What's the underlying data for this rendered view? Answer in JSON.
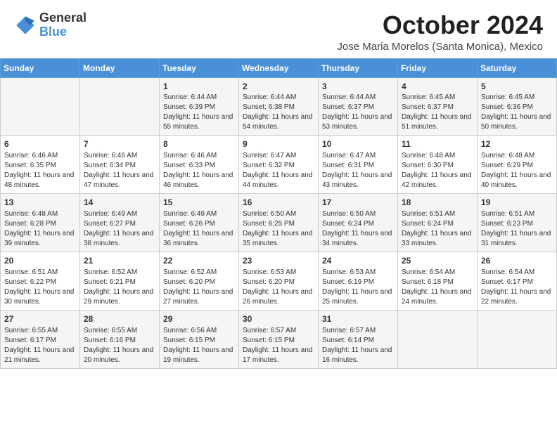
{
  "header": {
    "logo_general": "General",
    "logo_blue": "Blue",
    "month": "October 2024",
    "location": "Jose Maria Morelos (Santa Monica), Mexico"
  },
  "days_of_week": [
    "Sunday",
    "Monday",
    "Tuesday",
    "Wednesday",
    "Thursday",
    "Friday",
    "Saturday"
  ],
  "weeks": [
    [
      {
        "day": "",
        "info": ""
      },
      {
        "day": "",
        "info": ""
      },
      {
        "day": "1",
        "info": "Sunrise: 6:44 AM\nSunset: 6:39 PM\nDaylight: 11 hours and 55 minutes."
      },
      {
        "day": "2",
        "info": "Sunrise: 6:44 AM\nSunset: 6:38 PM\nDaylight: 11 hours and 54 minutes."
      },
      {
        "day": "3",
        "info": "Sunrise: 6:44 AM\nSunset: 6:37 PM\nDaylight: 11 hours and 53 minutes."
      },
      {
        "day": "4",
        "info": "Sunrise: 6:45 AM\nSunset: 6:37 PM\nDaylight: 11 hours and 51 minutes."
      },
      {
        "day": "5",
        "info": "Sunrise: 6:45 AM\nSunset: 6:36 PM\nDaylight: 11 hours and 50 minutes."
      }
    ],
    [
      {
        "day": "6",
        "info": "Sunrise: 6:46 AM\nSunset: 6:35 PM\nDaylight: 11 hours and 48 minutes."
      },
      {
        "day": "7",
        "info": "Sunrise: 6:46 AM\nSunset: 6:34 PM\nDaylight: 11 hours and 47 minutes."
      },
      {
        "day": "8",
        "info": "Sunrise: 6:46 AM\nSunset: 6:33 PM\nDaylight: 11 hours and 46 minutes."
      },
      {
        "day": "9",
        "info": "Sunrise: 6:47 AM\nSunset: 6:32 PM\nDaylight: 11 hours and 44 minutes."
      },
      {
        "day": "10",
        "info": "Sunrise: 6:47 AM\nSunset: 6:31 PM\nDaylight: 11 hours and 43 minutes."
      },
      {
        "day": "11",
        "info": "Sunrise: 6:48 AM\nSunset: 6:30 PM\nDaylight: 11 hours and 42 minutes."
      },
      {
        "day": "12",
        "info": "Sunrise: 6:48 AM\nSunset: 6:29 PM\nDaylight: 11 hours and 40 minutes."
      }
    ],
    [
      {
        "day": "13",
        "info": "Sunrise: 6:48 AM\nSunset: 6:28 PM\nDaylight: 11 hours and 39 minutes."
      },
      {
        "day": "14",
        "info": "Sunrise: 6:49 AM\nSunset: 6:27 PM\nDaylight: 11 hours and 38 minutes."
      },
      {
        "day": "15",
        "info": "Sunrise: 6:49 AM\nSunset: 6:26 PM\nDaylight: 11 hours and 36 minutes."
      },
      {
        "day": "16",
        "info": "Sunrise: 6:50 AM\nSunset: 6:25 PM\nDaylight: 11 hours and 35 minutes."
      },
      {
        "day": "17",
        "info": "Sunrise: 6:50 AM\nSunset: 6:24 PM\nDaylight: 11 hours and 34 minutes."
      },
      {
        "day": "18",
        "info": "Sunrise: 6:51 AM\nSunset: 6:24 PM\nDaylight: 11 hours and 33 minutes."
      },
      {
        "day": "19",
        "info": "Sunrise: 6:51 AM\nSunset: 6:23 PM\nDaylight: 11 hours and 31 minutes."
      }
    ],
    [
      {
        "day": "20",
        "info": "Sunrise: 6:51 AM\nSunset: 6:22 PM\nDaylight: 11 hours and 30 minutes."
      },
      {
        "day": "21",
        "info": "Sunrise: 6:52 AM\nSunset: 6:21 PM\nDaylight: 11 hours and 29 minutes."
      },
      {
        "day": "22",
        "info": "Sunrise: 6:52 AM\nSunset: 6:20 PM\nDaylight: 11 hours and 27 minutes."
      },
      {
        "day": "23",
        "info": "Sunrise: 6:53 AM\nSunset: 6:20 PM\nDaylight: 11 hours and 26 minutes."
      },
      {
        "day": "24",
        "info": "Sunrise: 6:53 AM\nSunset: 6:19 PM\nDaylight: 11 hours and 25 minutes."
      },
      {
        "day": "25",
        "info": "Sunrise: 6:54 AM\nSunset: 6:18 PM\nDaylight: 11 hours and 24 minutes."
      },
      {
        "day": "26",
        "info": "Sunrise: 6:54 AM\nSunset: 6:17 PM\nDaylight: 11 hours and 22 minutes."
      }
    ],
    [
      {
        "day": "27",
        "info": "Sunrise: 6:55 AM\nSunset: 6:17 PM\nDaylight: 11 hours and 21 minutes."
      },
      {
        "day": "28",
        "info": "Sunrise: 6:55 AM\nSunset: 6:16 PM\nDaylight: 11 hours and 20 minutes."
      },
      {
        "day": "29",
        "info": "Sunrise: 6:56 AM\nSunset: 6:15 PM\nDaylight: 11 hours and 19 minutes."
      },
      {
        "day": "30",
        "info": "Sunrise: 6:57 AM\nSunset: 6:15 PM\nDaylight: 11 hours and 17 minutes."
      },
      {
        "day": "31",
        "info": "Sunrise: 6:57 AM\nSunset: 6:14 PM\nDaylight: 11 hours and 16 minutes."
      },
      {
        "day": "",
        "info": ""
      },
      {
        "day": "",
        "info": ""
      }
    ]
  ]
}
